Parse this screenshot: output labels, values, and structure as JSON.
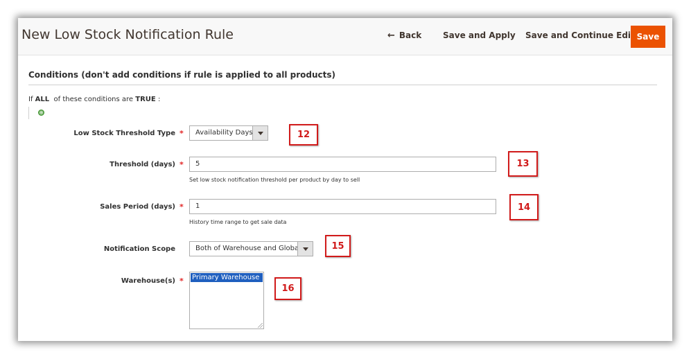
{
  "header": {
    "title": "New Low Stock Notification Rule",
    "back_label": "Back",
    "save_apply_label": "Save and Apply",
    "save_continue_label": "Save and Continue Edit",
    "save_label": "Save"
  },
  "conditions": {
    "section_title": "Conditions (don't add conditions if rule is applied to all products)",
    "prefix": "If",
    "aggregator": "ALL",
    "middle": "of these conditions are",
    "value": "TRUE",
    "suffix": ":",
    "add_icon": "⊕"
  },
  "form": {
    "threshold_type": {
      "label": "Low Stock Threshold Type",
      "value": "Availability Days",
      "required": true
    },
    "threshold": {
      "label": "Threshold (days)",
      "value": "5",
      "note": "Set low stock notification threshold per product by day to sell",
      "required": true
    },
    "sales_period": {
      "label": "Sales Period (days)",
      "value": "1",
      "note": "History time range to get sale data",
      "required": true
    },
    "scope": {
      "label": "Notification Scope",
      "value": "Both of Warehouse and Global",
      "required": false
    },
    "warehouses": {
      "label": "Warehouse(s)",
      "options": [
        "Primary Warehouse"
      ],
      "required": true
    }
  },
  "required_mark": "*",
  "callouts": [
    "12",
    "13",
    "14",
    "15",
    "16"
  ],
  "colors": {
    "accent": "#eb5202",
    "callout": "#d11a1a",
    "selected_option": "#1f5fbf",
    "required": "#e22626"
  }
}
